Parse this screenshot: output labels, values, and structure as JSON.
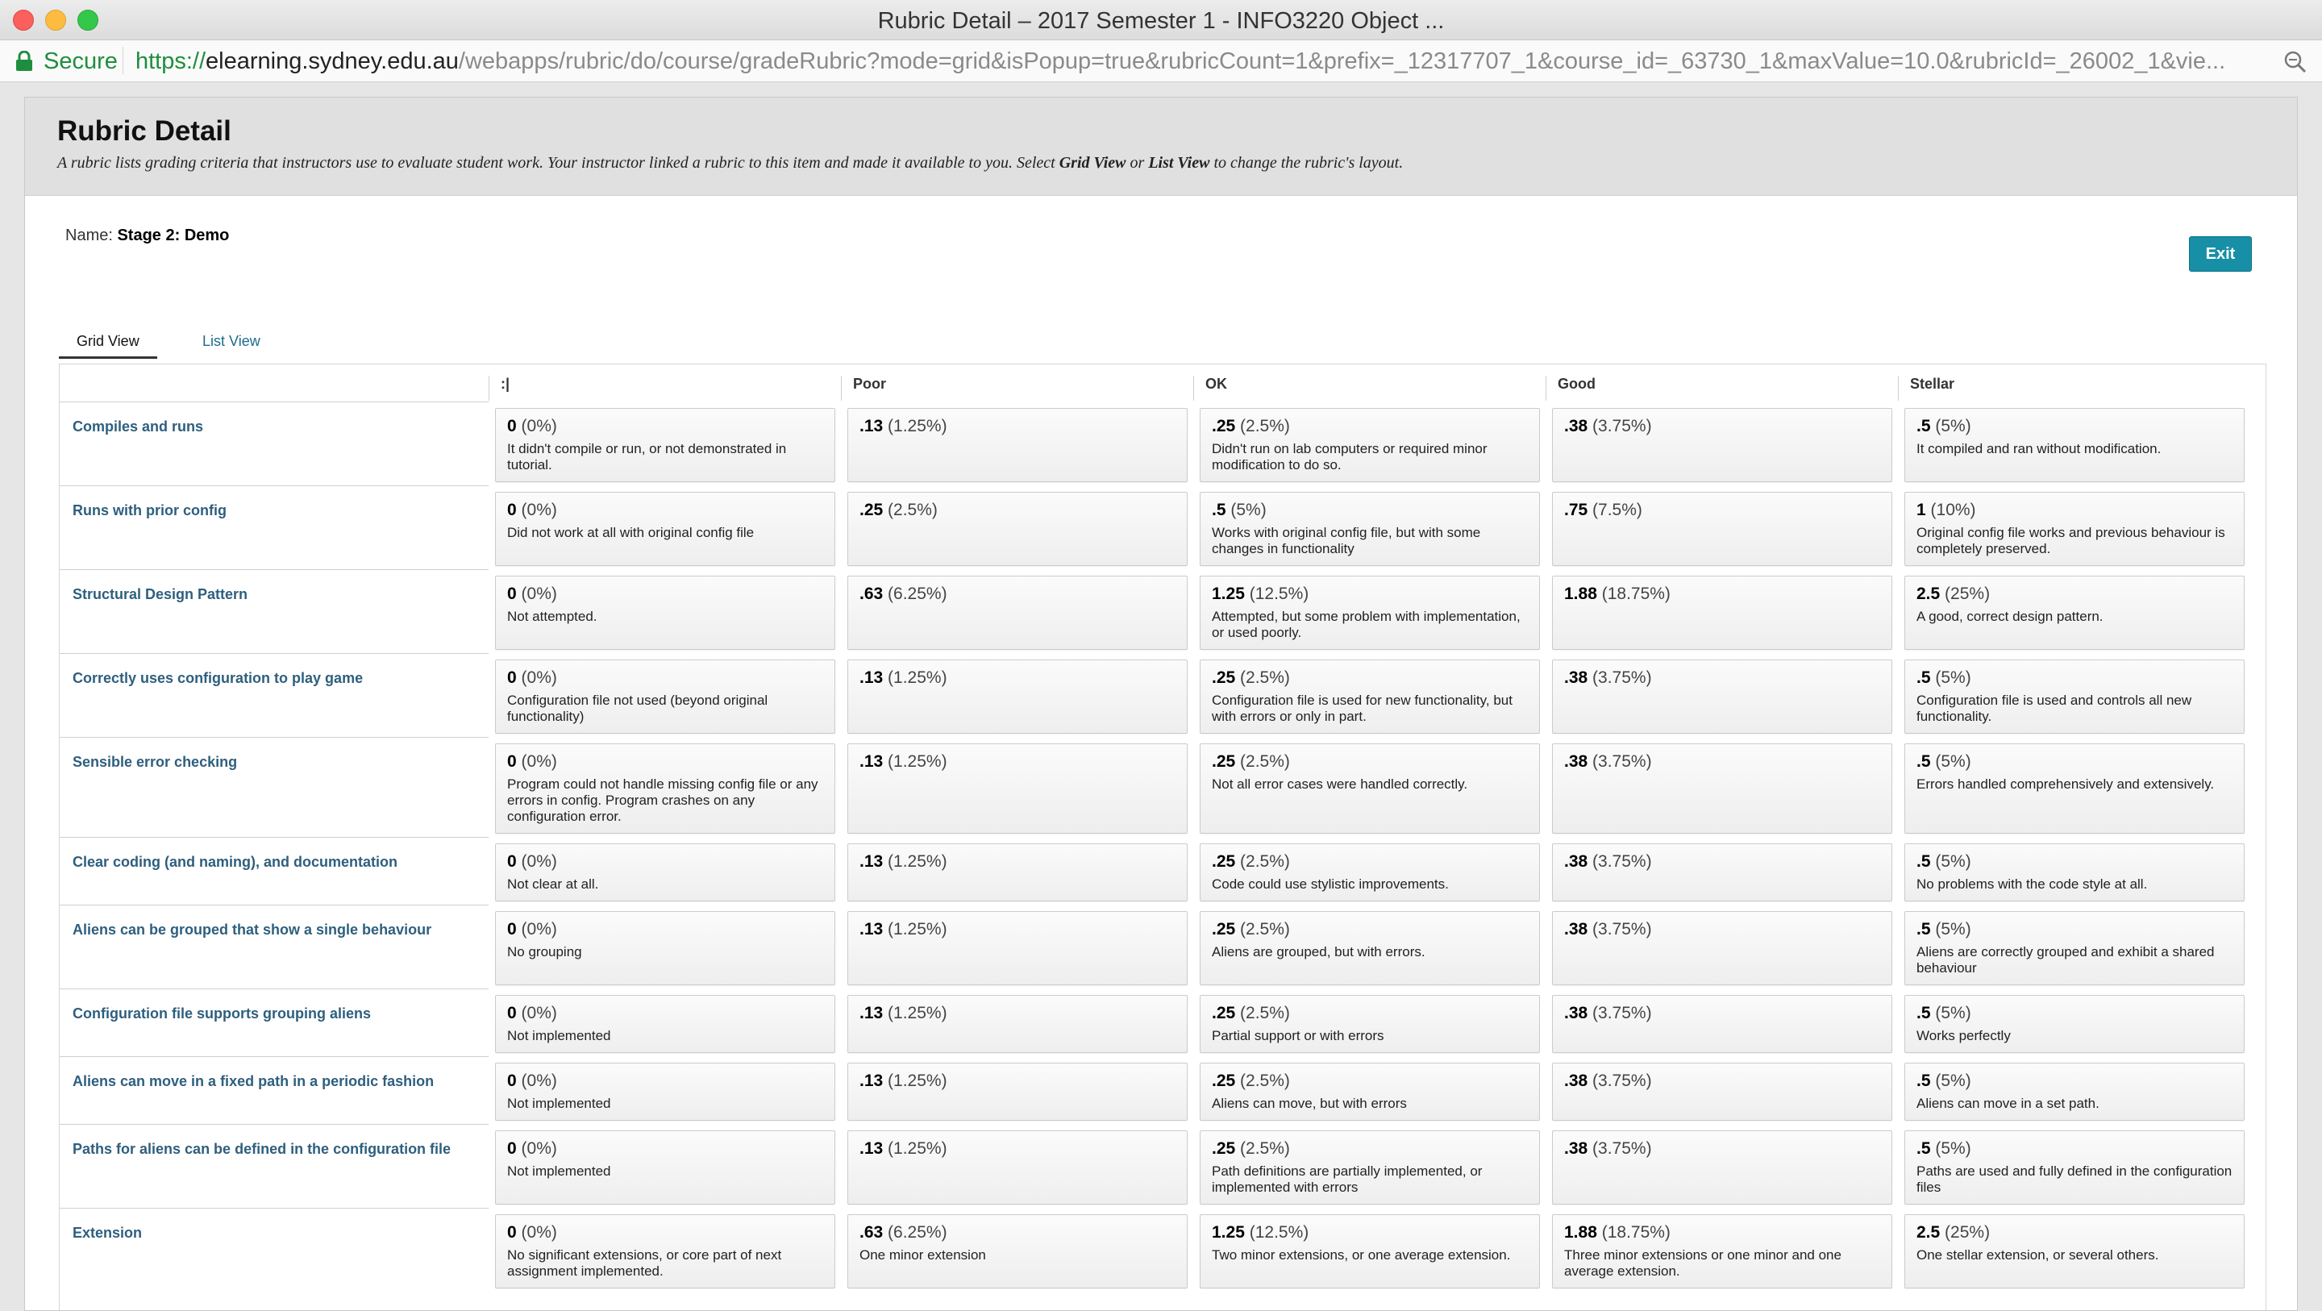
{
  "window": {
    "title": "Rubric Detail – 2017 Semester 1 - INFO3220 Object ..."
  },
  "address": {
    "secure_label": "Secure",
    "scheme": "https://",
    "host": "elearning.sydney.edu.au",
    "path": "/webapps/rubric/do/course/gradeRubric?mode=grid&isPopup=true&rubricCount=1&prefix=_12317707_1&course_id=_63730_1&maxValue=10.0&rubricId=_26002_1&vie..."
  },
  "header": {
    "title": "Rubric Detail",
    "desc_1": "A rubric lists grading criteria that instructors use to evaluate student work. Your instructor linked a rubric to this item and made it available to you. Select ",
    "desc_grid": "Grid View",
    "desc_2": " or ",
    "desc_list": "List View",
    "desc_3": " to change the rubric's layout."
  },
  "rubric": {
    "name_label": "Name: ",
    "name_value": "Stage 2: Demo"
  },
  "exit_label": "Exit",
  "tabs": {
    "grid": "Grid View",
    "list": "List View"
  },
  "levels": [
    ":|",
    "Poor",
    "OK",
    "Good",
    "Stellar"
  ],
  "rows": [
    {
      "criterion": "Compiles and runs",
      "cells": [
        {
          "pts": "0",
          "pct": "(0%)",
          "desc": "It didn't compile or run, or not demonstrated in tutorial."
        },
        {
          "pts": ".13",
          "pct": "(1.25%)",
          "desc": ""
        },
        {
          "pts": ".25",
          "pct": "(2.5%)",
          "desc": "Didn't run on lab computers or required minor modification to do so."
        },
        {
          "pts": ".38",
          "pct": "(3.75%)",
          "desc": ""
        },
        {
          "pts": ".5",
          "pct": "(5%)",
          "desc": "It compiled and ran without modification."
        }
      ]
    },
    {
      "criterion": "Runs with prior config",
      "cells": [
        {
          "pts": "0",
          "pct": "(0%)",
          "desc": "Did not work at all with original config file"
        },
        {
          "pts": ".25",
          "pct": "(2.5%)",
          "desc": ""
        },
        {
          "pts": ".5",
          "pct": "(5%)",
          "desc": "Works with original config file, but with some changes in functionality"
        },
        {
          "pts": ".75",
          "pct": "(7.5%)",
          "desc": ""
        },
        {
          "pts": "1",
          "pct": "(10%)",
          "desc": "Original config file works and previous behaviour is completely preserved."
        }
      ]
    },
    {
      "criterion": "Structural Design Pattern",
      "cells": [
        {
          "pts": "0",
          "pct": "(0%)",
          "desc": "Not attempted."
        },
        {
          "pts": ".63",
          "pct": "(6.25%)",
          "desc": ""
        },
        {
          "pts": "1.25",
          "pct": "(12.5%)",
          "desc": "Attempted, but some problem with implementation, or used poorly."
        },
        {
          "pts": "1.88",
          "pct": "(18.75%)",
          "desc": ""
        },
        {
          "pts": "2.5",
          "pct": "(25%)",
          "desc": "A good, correct design pattern."
        }
      ]
    },
    {
      "criterion": "Correctly uses configuration to play game",
      "cells": [
        {
          "pts": "0",
          "pct": "(0%)",
          "desc": "Configuration file not used (beyond original functionality)"
        },
        {
          "pts": ".13",
          "pct": "(1.25%)",
          "desc": ""
        },
        {
          "pts": ".25",
          "pct": "(2.5%)",
          "desc": "Configuration file is used for new functionality, but with errors or only in part."
        },
        {
          "pts": ".38",
          "pct": "(3.75%)",
          "desc": ""
        },
        {
          "pts": ".5",
          "pct": "(5%)",
          "desc": "Configuration file is used and controls all new functionality."
        }
      ]
    },
    {
      "criterion": "Sensible error checking",
      "cells": [
        {
          "pts": "0",
          "pct": "(0%)",
          "desc": "Program could not handle missing config file or any errors in config. Program crashes on any configuration error."
        },
        {
          "pts": ".13",
          "pct": "(1.25%)",
          "desc": ""
        },
        {
          "pts": ".25",
          "pct": "(2.5%)",
          "desc": "Not all error cases were handled correctly."
        },
        {
          "pts": ".38",
          "pct": "(3.75%)",
          "desc": ""
        },
        {
          "pts": ".5",
          "pct": "(5%)",
          "desc": "Errors handled comprehensively and extensively."
        }
      ]
    },
    {
      "criterion": "Clear coding (and naming), and documentation",
      "cells": [
        {
          "pts": "0",
          "pct": "(0%)",
          "desc": "Not clear at all."
        },
        {
          "pts": ".13",
          "pct": "(1.25%)",
          "desc": ""
        },
        {
          "pts": ".25",
          "pct": "(2.5%)",
          "desc": "Code could use stylistic improvements."
        },
        {
          "pts": ".38",
          "pct": "(3.75%)",
          "desc": ""
        },
        {
          "pts": ".5",
          "pct": "(5%)",
          "desc": "No problems with the code style at all."
        }
      ]
    },
    {
      "criterion": "Aliens can be grouped that show a single behaviour",
      "cells": [
        {
          "pts": "0",
          "pct": "(0%)",
          "desc": "No grouping"
        },
        {
          "pts": ".13",
          "pct": "(1.25%)",
          "desc": ""
        },
        {
          "pts": ".25",
          "pct": "(2.5%)",
          "desc": "Aliens are grouped, but with errors."
        },
        {
          "pts": ".38",
          "pct": "(3.75%)",
          "desc": ""
        },
        {
          "pts": ".5",
          "pct": "(5%)",
          "desc": "Aliens are correctly grouped and exhibit a shared behaviour"
        }
      ]
    },
    {
      "criterion": "Configuration file supports grouping aliens",
      "cells": [
        {
          "pts": "0",
          "pct": "(0%)",
          "desc": "Not implemented"
        },
        {
          "pts": ".13",
          "pct": "(1.25%)",
          "desc": ""
        },
        {
          "pts": ".25",
          "pct": "(2.5%)",
          "desc": "Partial support or with errors"
        },
        {
          "pts": ".38",
          "pct": "(3.75%)",
          "desc": ""
        },
        {
          "pts": ".5",
          "pct": "(5%)",
          "desc": "Works perfectly"
        }
      ]
    },
    {
      "criterion": "Aliens can move in a fixed path in a periodic fashion",
      "cells": [
        {
          "pts": "0",
          "pct": "(0%)",
          "desc": "Not implemented"
        },
        {
          "pts": ".13",
          "pct": "(1.25%)",
          "desc": ""
        },
        {
          "pts": ".25",
          "pct": "(2.5%)",
          "desc": "Aliens can move, but with errors"
        },
        {
          "pts": ".38",
          "pct": "(3.75%)",
          "desc": ""
        },
        {
          "pts": ".5",
          "pct": "(5%)",
          "desc": "Aliens can move in a set path."
        }
      ]
    },
    {
      "criterion": "Paths for aliens can be defined in the configuration file",
      "cells": [
        {
          "pts": "0",
          "pct": "(0%)",
          "desc": "Not implemented"
        },
        {
          "pts": ".13",
          "pct": "(1.25%)",
          "desc": ""
        },
        {
          "pts": ".25",
          "pct": "(2.5%)",
          "desc": "Path definitions are partially implemented, or implemented with errors"
        },
        {
          "pts": ".38",
          "pct": "(3.75%)",
          "desc": ""
        },
        {
          "pts": ".5",
          "pct": "(5%)",
          "desc": "Paths are used and fully defined in the configuration files"
        }
      ]
    },
    {
      "criterion": "Extension",
      "cells": [
        {
          "pts": "0",
          "pct": "(0%)",
          "desc": "No significant extensions, or core part of next assignment implemented."
        },
        {
          "pts": ".63",
          "pct": "(6.25%)",
          "desc": "One minor extension"
        },
        {
          "pts": "1.25",
          "pct": "(12.5%)",
          "desc": "Two minor extensions, or one average extension."
        },
        {
          "pts": "1.88",
          "pct": "(18.75%)",
          "desc": "Three minor extensions or one minor and one average extension."
        },
        {
          "pts": "2.5",
          "pct": "(25%)",
          "desc": "One stellar extension, or several others."
        }
      ]
    }
  ]
}
